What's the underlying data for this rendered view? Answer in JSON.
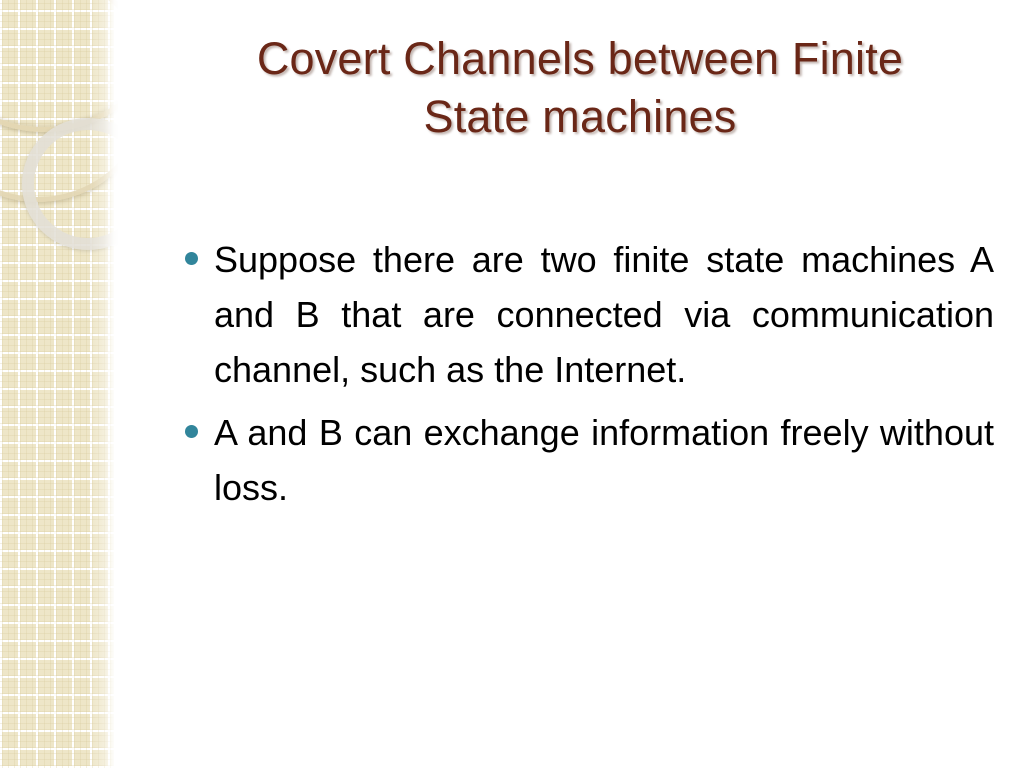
{
  "slide": {
    "background_color": "#ffffff",
    "title": {
      "lines": [
        "Covert Channels between Finite",
        "State machines"
      ],
      "color": "#6A2717"
    },
    "body": {
      "bullet_color": "#31859B",
      "text_color": "#000000",
      "bullets": [
        "Suppose there are two finite state machines A and B that are connected via communication channel, such as the Internet.",
        "A and B can exchange information freely without loss."
      ]
    },
    "decoration": {
      "band_color": "#eee6c8",
      "grid_line_color": "#ffffff",
      "ring_cream_color": "#e3d6b2",
      "ring_gray_color": "#e2dfd6"
    }
  }
}
